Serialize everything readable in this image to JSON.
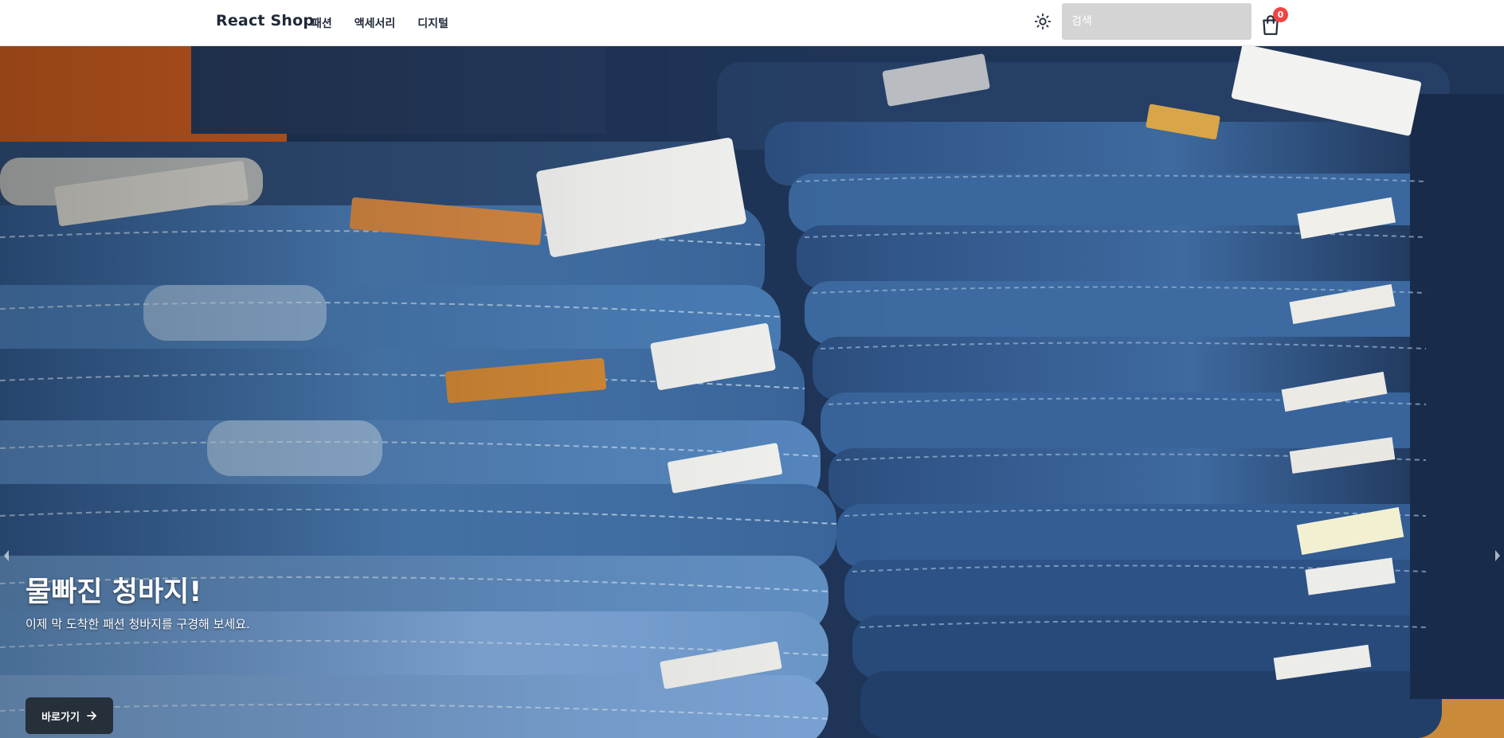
{
  "navbar": {
    "brand": "React Shop",
    "menu": [
      {
        "label": "패션"
      },
      {
        "label": "액세서리"
      },
      {
        "label": "디지털"
      }
    ],
    "theme_icon": "sun-icon",
    "search": {
      "placeholder": "검색",
      "value": ""
    },
    "cart": {
      "icon": "shopping-bag-icon",
      "count": "0"
    }
  },
  "hero": {
    "title": "물빠진 청바지!",
    "subtitle": "이제 막 도착한 패션 청바지를 구경해 보세요.",
    "button_label": "바로가기",
    "button_icon": "arrow-right-icon",
    "image": "stacked-denim-jeans-photo",
    "prev_icon": "caret-left-icon",
    "next_icon": "caret-right-icon"
  },
  "colors": {
    "badge": "#ef4444",
    "search_bg": "#d4d4d4",
    "button_bg": "#26303b",
    "denim": "#3f6ea5"
  }
}
